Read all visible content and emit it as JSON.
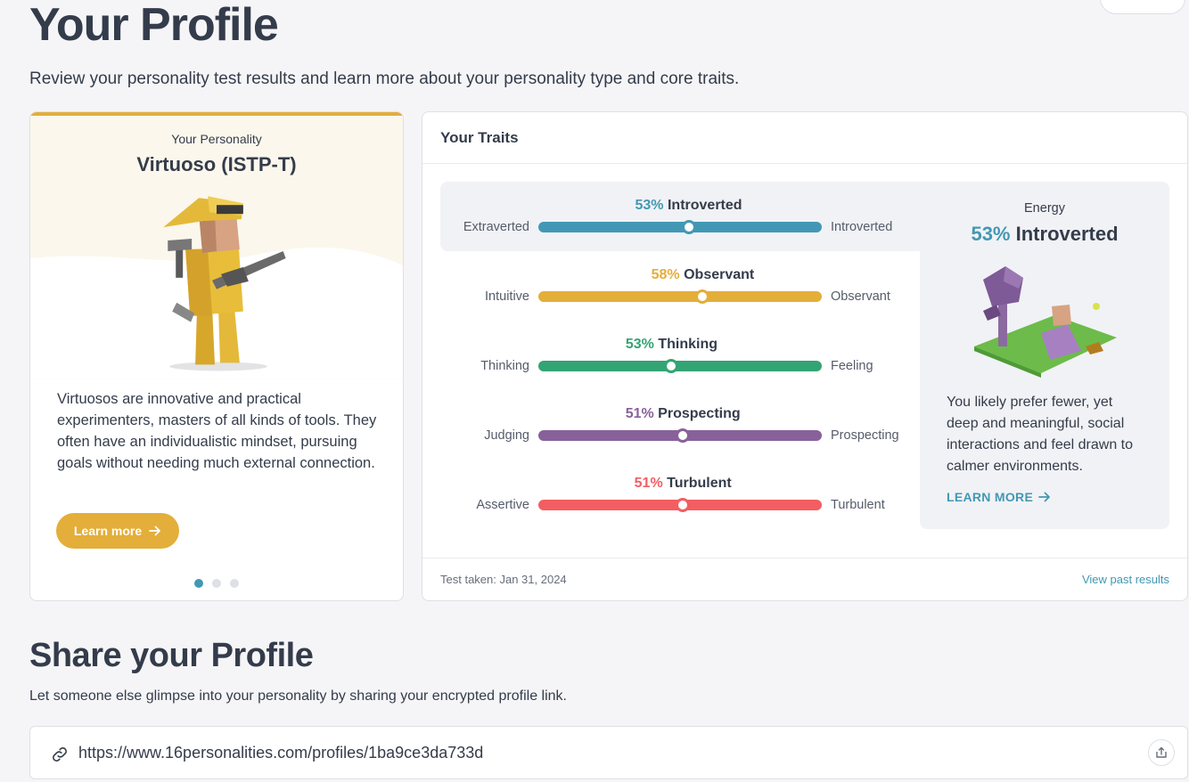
{
  "header": {
    "title": "Your Profile",
    "subtitle": "Review your personality test results and learn more about your personality type and core traits."
  },
  "personality": {
    "label": "Your Personality",
    "type": "Virtuoso (ISTP-T)",
    "description": "Virtuosos are innovative and practical experimenters, masters of all kinds of tools. They often have an individualistic mindset, pursuing goals without needing much external connection.",
    "learn_more": "Learn more",
    "carousel_active": 1,
    "carousel_count": 3,
    "accent_color": "#e4ae3a"
  },
  "traits": {
    "title": "Your Traits",
    "items": [
      {
        "pct": "53%",
        "name": "Introverted",
        "left": "Extraverted",
        "right": "Introverted",
        "position": 0.53,
        "color": "#4298b4"
      },
      {
        "pct": "58%",
        "name": "Observant",
        "left": "Intuitive",
        "right": "Observant",
        "position": 0.58,
        "color": "#e4ae3a"
      },
      {
        "pct": "53%",
        "name": "Thinking",
        "left": "Thinking",
        "right": "Feeling",
        "position": 0.47,
        "color": "#33a474"
      },
      {
        "pct": "51%",
        "name": "Prospecting",
        "left": "Judging",
        "right": "Prospecting",
        "position": 0.51,
        "color": "#88619a"
      },
      {
        "pct": "51%",
        "name": "Turbulent",
        "left": "Assertive",
        "right": "Turbulent",
        "position": 0.51,
        "color": "#f25e62"
      }
    ],
    "energy": {
      "label": "Energy",
      "pct": "53%",
      "name": "Introverted",
      "description": "You likely prefer fewer, yet deep and meaningful, social interactions and feel drawn to calmer environments.",
      "link": "LEARN MORE"
    },
    "test_date": "Test taken: Jan 31, 2024",
    "past_results": "View past results"
  },
  "share": {
    "title": "Share your Profile",
    "subtitle": "Let someone else glimpse into your personality by sharing your encrypted profile link.",
    "url": "https://www.16personalities.com/profiles/1ba9ce3da733d"
  }
}
